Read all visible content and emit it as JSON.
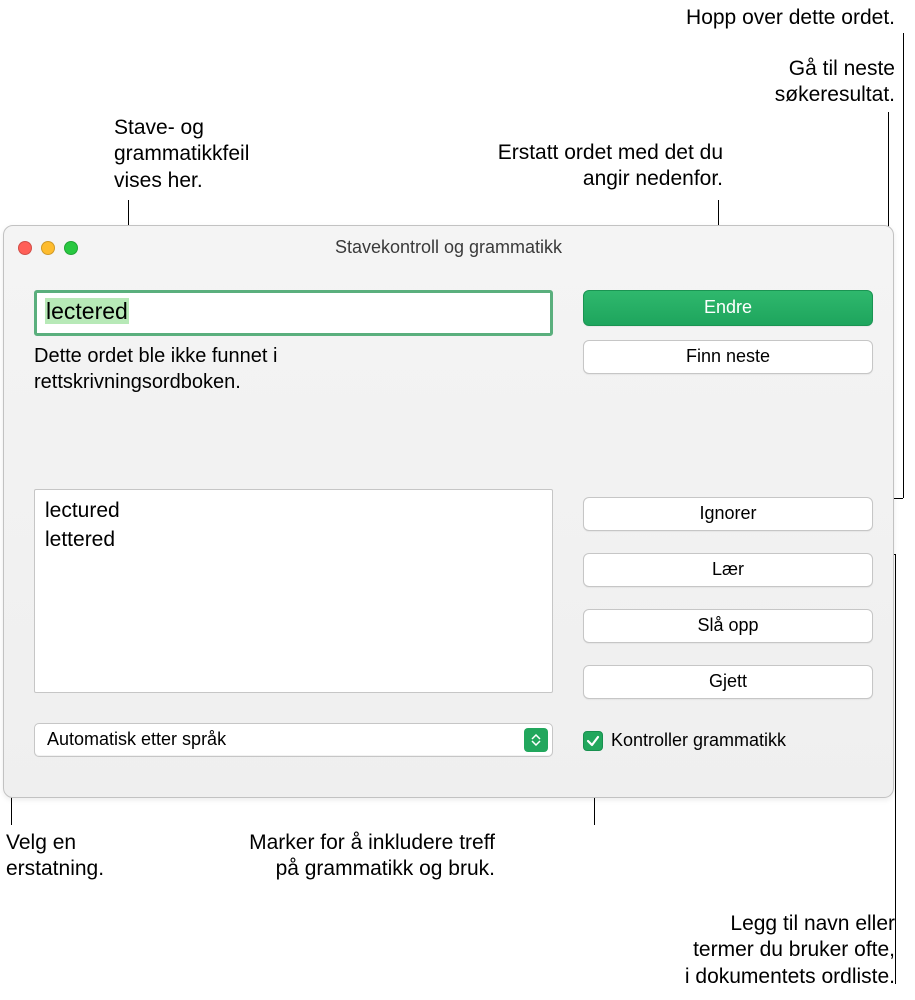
{
  "callouts": {
    "skip": "Hopp over dette ordet.",
    "next": "Gå til neste\nsøkeresultat.",
    "errors_here": "Stave- og\ngrammatikkfeil\nvises her.",
    "replace": "Erstatt ordet med det du\nangir nedenfor.",
    "pick_replacement": "Velg en\nerstatning.",
    "grammar_check": "Marker for å inkludere treff\npå grammatikk og bruk.",
    "learn": "Legg til navn eller\ntermer du bruker ofte,\ni dokumentets ordliste."
  },
  "window": {
    "title": "Stavekontroll og grammatikk",
    "word": "lectered",
    "message": "Dette ordet ble ikke funnet i\nrettskrivningsordboken.",
    "suggestions": [
      "lectured",
      "lettered"
    ],
    "language": "Automatisk etter språk",
    "checkbox_label": "Kontroller grammatikk",
    "checkbox_checked": true,
    "buttons": {
      "change": "Endre",
      "find_next": "Finn neste",
      "ignore": "Ignorer",
      "learn": "Lær",
      "lookup": "Slå opp",
      "guess": "Gjett"
    }
  }
}
